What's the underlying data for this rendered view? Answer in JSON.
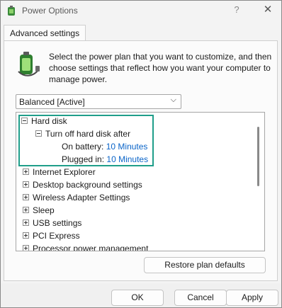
{
  "window": {
    "title": "Power Options",
    "help_label": "?",
    "close_label": "✕"
  },
  "tab": {
    "label": "Advanced settings"
  },
  "description": "Select the power plan that you want to customize, and then choose settings that reflect how you want your computer to manage power.",
  "plan_select": {
    "value": "Balanced [Active]"
  },
  "tree": {
    "hard_disk": {
      "label": "Hard disk",
      "turn_off": {
        "label": "Turn off hard disk after",
        "on_battery": {
          "label": "On battery:",
          "value": "10 Minutes"
        },
        "plugged_in": {
          "label": "Plugged in:",
          "value": "10 Minutes"
        }
      }
    },
    "items": [
      "Internet Explorer",
      "Desktop background settings",
      "Wireless Adapter Settings",
      "Sleep",
      "USB settings",
      "PCI Express",
      "Processor power management"
    ]
  },
  "buttons": {
    "restore": "Restore plan defaults",
    "ok": "OK",
    "cancel": "Cancel",
    "apply": "Apply"
  },
  "colors": {
    "highlight": "#1f9e8a",
    "link": "#0a64c8"
  },
  "icons": {
    "app": "power-options-icon",
    "battery": "battery-plug-icon"
  }
}
